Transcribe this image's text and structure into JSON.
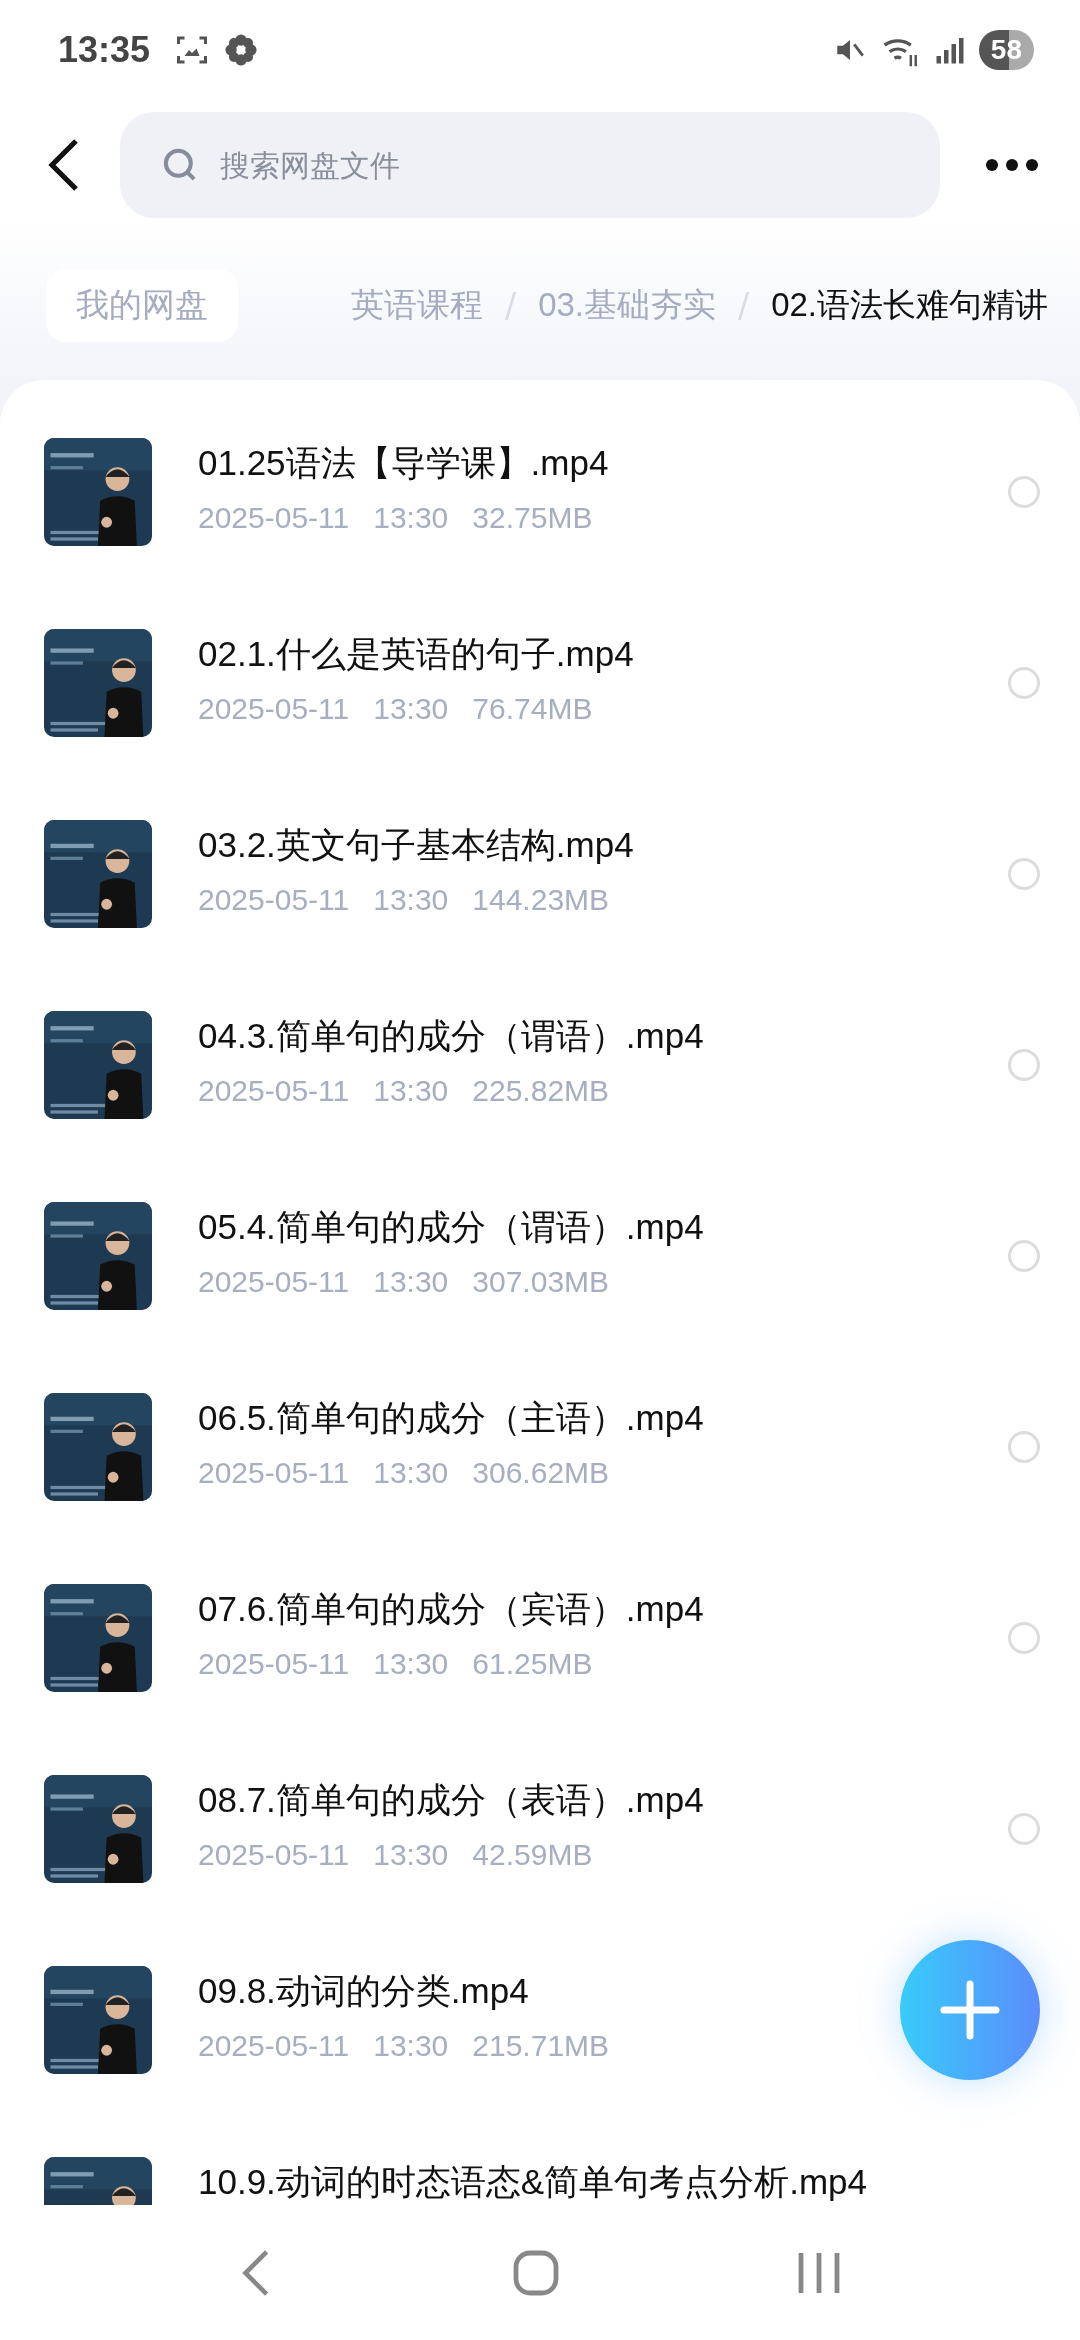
{
  "status_bar": {
    "time": "13:35",
    "battery": "58"
  },
  "search": {
    "placeholder": "搜索网盘文件"
  },
  "breadcrumb": [
    {
      "label": "我的网盘",
      "kind": "root",
      "current": false
    },
    {
      "label": "英语课程",
      "kind": "crumb",
      "current": false
    },
    {
      "label": "03.基础夯实",
      "kind": "crumb",
      "current": false,
      "separator": "/"
    },
    {
      "label": "02.语法长难句精讲",
      "kind": "crumb",
      "current": true,
      "separator": "/"
    }
  ],
  "files": [
    {
      "name": "01.25语法【导学课】.mp4",
      "date": "2025-05-11",
      "time": "13:30",
      "size": "32.75MB",
      "selected": false
    },
    {
      "name": "02.1.什么是英语的句子.mp4",
      "date": "2025-05-11",
      "time": "13:30",
      "size": "76.74MB",
      "selected": false
    },
    {
      "name": "03.2.英文句子基本结构.mp4",
      "date": "2025-05-11",
      "time": "13:30",
      "size": "144.23MB",
      "selected": false
    },
    {
      "name": "04.3.简单句的成分（谓语）.mp4",
      "date": "2025-05-11",
      "time": "13:30",
      "size": "225.82MB",
      "selected": false
    },
    {
      "name": "05.4.简单句的成分（谓语）.mp4",
      "date": "2025-05-11",
      "time": "13:30",
      "size": "307.03MB",
      "selected": false
    },
    {
      "name": "06.5.简单句的成分（主语）.mp4",
      "date": "2025-05-11",
      "time": "13:30",
      "size": "306.62MB",
      "selected": false
    },
    {
      "name": "07.6.简单句的成分（宾语）.mp4",
      "date": "2025-05-11",
      "time": "13:30",
      "size": "61.25MB",
      "selected": false
    },
    {
      "name": "08.7.简单句的成分（表语）.mp4",
      "date": "2025-05-11",
      "time": "13:30",
      "size": "42.59MB",
      "selected": false
    },
    {
      "name": "09.8.动词的分类.mp4",
      "date": "2025-05-11",
      "time": "13:30",
      "size": "215.71MB"
    },
    {
      "name": "10.9.动词的时态语态&简单句考点分析.mp4"
    }
  ]
}
